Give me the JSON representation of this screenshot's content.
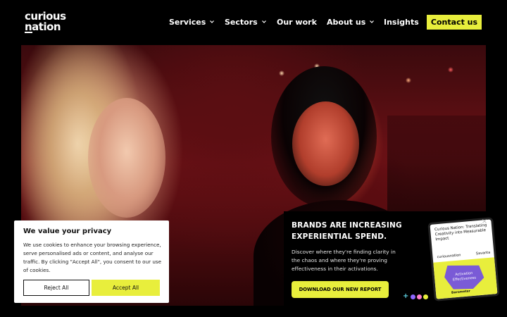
{
  "header": {
    "logo_line1": "curious",
    "logo_line2": "nation",
    "nav": [
      {
        "label": "Services",
        "has_dropdown": true
      },
      {
        "label": "Sectors",
        "has_dropdown": true
      },
      {
        "label": "Our work",
        "has_dropdown": false
      },
      {
        "label": "About us",
        "has_dropdown": true
      },
      {
        "label": "Insights",
        "has_dropdown": false
      }
    ],
    "contact_label": "Contact us"
  },
  "cookie": {
    "title": "We value your privacy",
    "text": "We use cookies to enhance your browsing experience, serve personalised ads or content, and analyse our traffic. By clicking \"Accept All\", you consent to our use of cookies.",
    "reject_label": "Reject All",
    "accept_label": "Accept All"
  },
  "report": {
    "title": "BRANDS ARE INCREASING EXPERIENTIAL SPEND.",
    "text": "Discover where they're finding clarity in the chaos and where they're proving effectiveness in their activations.",
    "download_label": "DOWNLOAD OUR NEW REPORT",
    "close_icon": "×",
    "tablet": {
      "title": "Curious Nation: Translating Creativity into Measurable Impact",
      "brand_left": "curiousnation",
      "brand_right": "Savanta",
      "graphic_label": "Activation Effectiveness",
      "barometer": "Barometer"
    }
  },
  "colors": {
    "accent": "#e8ee3c",
    "background": "#000000",
    "dot_cyan": "#5fd5e6",
    "dot_purple": "#8f67ff",
    "dot_pink": "#ff7fc9",
    "dot_yellow": "#e8ee3c"
  }
}
